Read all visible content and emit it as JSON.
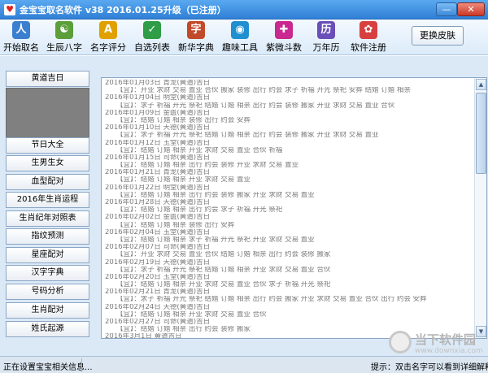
{
  "window": {
    "title": "金宝宝取名软件 v38  2016.01.25升级（已注册）",
    "min_label": "—",
    "close_label": "✕"
  },
  "toolbar": {
    "items": [
      {
        "label": "开始取名",
        "icon": "people-icon",
        "color": "#3b7fd0",
        "glyph": "人"
      },
      {
        "label": "生辰八字",
        "icon": "yin-yang-icon",
        "color": "#5b9e3a",
        "glyph": "☯"
      },
      {
        "label": "名字评分",
        "icon": "abc-book-icon",
        "color": "#e0a000",
        "glyph": "A"
      },
      {
        "label": "自选列表",
        "icon": "list-icon",
        "color": "#2f9c47",
        "glyph": "✓"
      },
      {
        "label": "新华字典",
        "icon": "dictionary-icon",
        "color": "#c04a2a",
        "glyph": "字"
      },
      {
        "label": "趣味工具",
        "icon": "globe-icon",
        "color": "#1f8fd0",
        "glyph": "◉"
      },
      {
        "label": "紫微斗数",
        "icon": "sign-icon",
        "color": "#c8288f",
        "glyph": "✚"
      },
      {
        "label": "万年历",
        "icon": "calendar-icon",
        "color": "#6a4fb8",
        "glyph": "历"
      },
      {
        "label": "软件注册",
        "icon": "gear-icon",
        "color": "#d84040",
        "glyph": "✿"
      }
    ],
    "skin_button": "更换皮肤"
  },
  "sidebar": {
    "top_button": "黄道吉日",
    "items": [
      "节日大全",
      "生男生女",
      "血型配对",
      "2016年生肖运程",
      "生肖纪年对照表",
      "指纹预测",
      "星座配对",
      "汉字字典",
      "号码分析",
      "生肖配对",
      "姓氏起源"
    ]
  },
  "log": {
    "lines": [
      "2016年01月03日 青龙(黄道)吉日",
      "【宜】：开业 求财 交易 置业 合伙 搬家 装修 出行 约会 求子 祈福 开光 祭祀 安葬 结婚 订婚 相亲",
      "2016年01月04日 明堂(黄道)吉日",
      "【宜】：求子 祈福 开光 祭祀 结婚 订婚 相亲 出行 约会 装修 搬家 开业 求财 交易 置业 合伙",
      "2016年01月09日 金匮(黄道)吉日",
      "【宜】：结婚 订婚 相亲 装修 出行 约会 安葬",
      "2016年01月10日 天德(黄道)吉日",
      "【宜】：求子 祈福 开光 祭祀 结婚 订婚 相亲 出行 约会 装修 搬家 开业 求财 交易 置业",
      "2016年01月12日 玉堂(黄道)吉日",
      "【宜】：结婚 订婚 相亲 开业 求财 交易 置业 合伙 祈福",
      "2016年01月15日 司命(黄道)吉日",
      "【宜】：结婚 订婚 相亲 出行 约会 装修 开业 求财 交易 置业",
      "2016年01月21日 青龙(黄道)吉日",
      "【宜】：结婚 订婚 相亲 开业 求财 交易 置业",
      "2016年01月22日 明堂(黄道)吉日",
      "【宜】：结婚 订婚 相亲 出行 约会 装修 搬家 开业 求财 交易 置业",
      "2016年01月28日 天德(黄道)吉日",
      "【宜】：结婚 订婚 相亲 出行 约会 求子 祈福 开光 祭祀",
      "2016年02月02日 金匮(黄道)吉日",
      "【宜】：结婚 订婚 相亲 装修 出行 安葬",
      "2016年02月04日 玉堂(黄道)吉日",
      "【宜】：结婚 订婚 相亲 求子 祈福 开光 祭祀 开业 求财 交易 置业",
      "2016年02月07日 司命(黄道)吉日",
      "【宜】：开业 求财 交易 置业 合伙 结婚 订婚 相亲 出行 约会 装修 搬家",
      "2016年02月19日 天德(黄道)吉日",
      "【宜】：求子 祈福 开光 祭祀 结婚 订婚 相亲 开业 求财 交易 置业 合伙",
      "2016年02月20日 玉堂(黄道)吉日",
      "【宜】：结婚 订婚 相亲 开业 求财 交易 置业 合伙 求子 祈福 开光 祭祀",
      "2016年02月21日 青龙(黄道)吉日",
      "【宜】：求子 祈福 开光 祭祀 结婚 订婚 相亲 出行 约会 搬家 开业 求财 交易 置业 合伙 出行 约会 安葬",
      "2016年02月24日 天德(黄道)吉日",
      "【宜】：结婚 订婚 相亲 开业 求财 交易 置业 合伙",
      "2016年02月27日 司命(黄道)吉日",
      "【宜】：结婚 订婚 相亲 出行 约会 装修 搬家",
      "2016年3月1日 黄道吉日",
      "【宜】：结婚 订婚 相亲 开业 求财 交易 置业 合伙 祈福 祭祀 装修 搬家",
      "2016年03月07日 司命(黄道)吉日",
      "【宜】：结婚 订婚 相亲 出行 约会 装修 搬家 开业 求财 交易 置业",
      "2016年03月14日 天德(黄道)吉日",
      "【宜】：结婚 订婚 相亲 开业 求财 交易 置业 合伙 求子 祈福 开光 祭祀"
    ]
  },
  "status": {
    "left": "正在设置宝宝相关信息...",
    "right": "提示：双击名字可以看到详细解释"
  },
  "watermark": {
    "text": "当下软件园",
    "sub": "www.downxia.com"
  }
}
